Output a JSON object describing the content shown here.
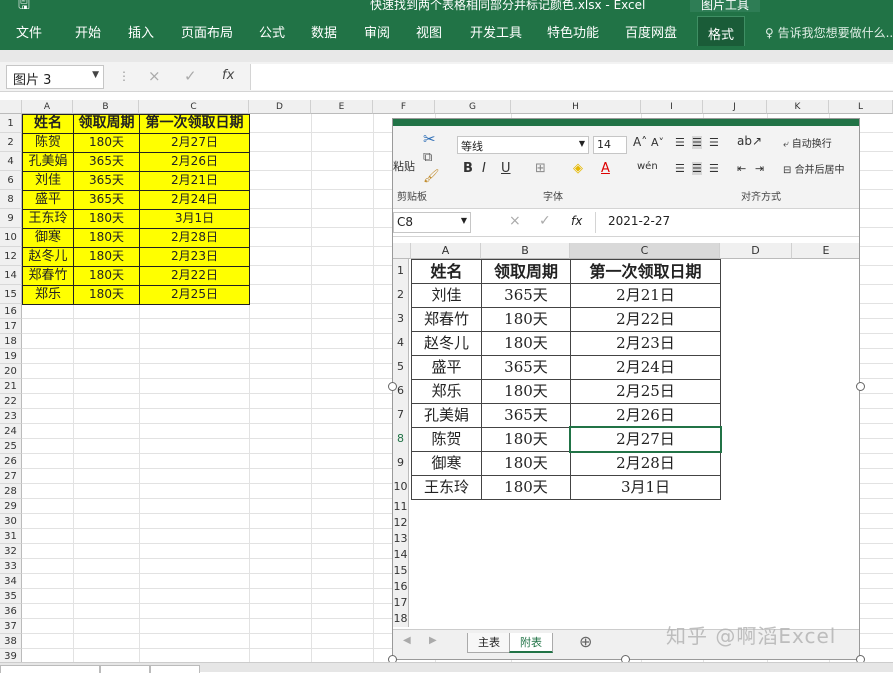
{
  "title_bar": {
    "filename": "快速找到两个表格相同部分并标记颜色.xlsx - Excel",
    "contextual_tab": "图片工具"
  },
  "ribbon": {
    "tabs": [
      "文件",
      "开始",
      "插入",
      "页面布局",
      "公式",
      "数据",
      "审阅",
      "视图",
      "开发工具",
      "特色功能",
      "百度网盘",
      "格式"
    ],
    "active_tab": "格式",
    "tell_me": "告诉我您想要做什么..."
  },
  "formula_bar": {
    "name_box": "图片 3",
    "cancel_icon": "×",
    "enter_icon": "✓",
    "fx_label": "fx",
    "value": ""
  },
  "sheet": {
    "columns": [
      "A",
      "B",
      "C",
      "D",
      "E",
      "F",
      "G",
      "H",
      "I",
      "J",
      "K",
      "L"
    ],
    "row_numbers": [
      "1",
      "2",
      "4",
      "6",
      "8",
      "9",
      "10",
      "12",
      "14",
      "15",
      "16",
      "17",
      "18",
      "19",
      "20",
      "21",
      "22",
      "23",
      "24",
      "25",
      "26",
      "27",
      "28",
      "29",
      "30",
      "31",
      "32",
      "33",
      "34",
      "35",
      "36",
      "37",
      "38",
      "39"
    ],
    "table": [
      [
        "姓名",
        "领取周期",
        "第一次领取日期"
      ],
      [
        "陈贺",
        "180天",
        "2月27日"
      ],
      [
        "孔美娟",
        "365天",
        "2月26日"
      ],
      [
        "刘佳",
        "365天",
        "2月21日"
      ],
      [
        "盛平",
        "365天",
        "2月24日"
      ],
      [
        "王东玲",
        "180天",
        "3月1日"
      ],
      [
        "御寒",
        "180天",
        "2月28日"
      ],
      [
        "赵冬儿",
        "180天",
        "2月23日"
      ],
      [
        "郑春竹",
        "180天",
        "2月22日"
      ],
      [
        "郑乐",
        "180天",
        "2月25日"
      ]
    ],
    "highlight_color": "#ffff00"
  },
  "inset": {
    "font_name": "等线",
    "font_size": "14",
    "groups": {
      "clipboard": "剪贴板",
      "font": "字体",
      "alignment": "对齐方式"
    },
    "paste_label": "粘贴",
    "wrap_text": "自动换行",
    "merge_center": "合并后居中",
    "name_box": "C8",
    "fx_label": "fx",
    "formula_value": "2021-2-27",
    "columns": [
      "A",
      "B",
      "C",
      "D",
      "E"
    ],
    "row_numbers": [
      "1",
      "2",
      "3",
      "4",
      "5",
      "6",
      "7",
      "8",
      "9",
      "10",
      "11",
      "12",
      "13",
      "14",
      "15",
      "16",
      "17",
      "18"
    ],
    "table": [
      [
        "姓名",
        "领取周期",
        "第一次领取日期"
      ],
      [
        "刘佳",
        "365天",
        "2月21日"
      ],
      [
        "郑春竹",
        "180天",
        "2月22日"
      ],
      [
        "赵冬儿",
        "180天",
        "2月23日"
      ],
      [
        "盛平",
        "365天",
        "2月24日"
      ],
      [
        "郑乐",
        "180天",
        "2月25日"
      ],
      [
        "孔美娟",
        "365天",
        "2月26日"
      ],
      [
        "陈贺",
        "180天",
        "2月27日"
      ],
      [
        "御寒",
        "180天",
        "2月28日"
      ],
      [
        "王东玲",
        "180天",
        "3月1日"
      ]
    ],
    "sheet_tabs": [
      "主表",
      "附表"
    ],
    "active_sheet": "附表",
    "add_sheet": "⊕"
  },
  "watermark": "知乎 @啊滔Excel",
  "accent_color": "#217346"
}
